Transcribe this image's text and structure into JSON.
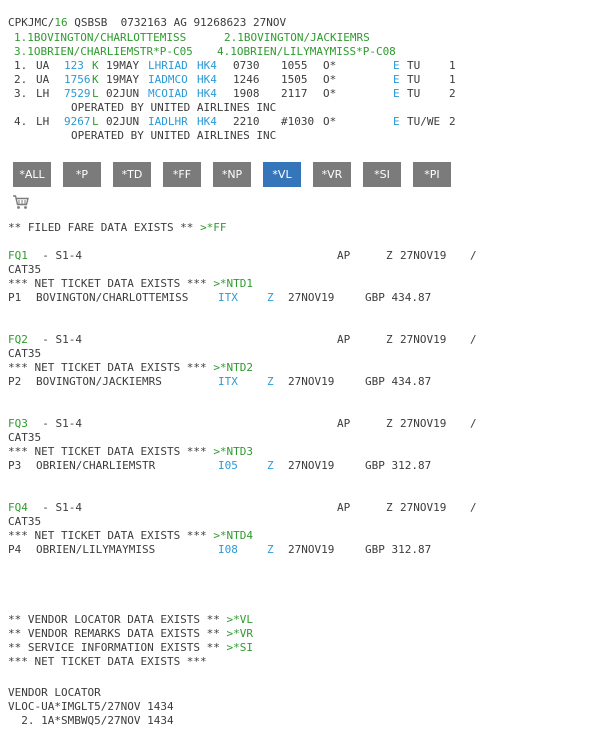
{
  "pnr": {
    "header": {
      "a": "CPKJMC/",
      "b": "16",
      "c": " QSBSB  0732163 AG 91268623 27NOV"
    },
    "names": {
      "n1": "1.1BOVINGTON/CHARLOTTEMISS",
      "n2": "2.1BOVINGTON/JACKIEMRS",
      "n3": "3.1OBRIEN/CHARLIEMSTR*P-C05",
      "n4": "4.1OBRIEN/LILYMAYMISS*P-C08"
    },
    "segments": [
      {
        "num": "1.",
        "air": "UA",
        "flt": "123",
        "cls": "K",
        "date": "19MAY",
        "city": "LHRIAD",
        "st": "HK4",
        "dep": "0730",
        "arr": "1055",
        "flag": "O*",
        "e": "E",
        "day": "TU",
        "n": "1",
        "op": ""
      },
      {
        "num": "2.",
        "air": "UA",
        "flt": "1756",
        "cls": "K",
        "date": "19MAY",
        "city": "IADMCO",
        "st": "HK4",
        "dep": "1246",
        "arr": "1505",
        "flag": "O*",
        "e": "E",
        "day": "TU",
        "n": "1",
        "op": ""
      },
      {
        "num": "3.",
        "air": "LH",
        "flt": "7529",
        "cls": "L",
        "date": "02JUN",
        "city": "MCOIAD",
        "st": "HK4",
        "dep": "1908",
        "arr": "2117",
        "flag": "O*",
        "e": "E",
        "day": "TU",
        "n": "2",
        "op": "OPERATED BY UNITED AIRLINES INC"
      },
      {
        "num": "4.",
        "air": "LH",
        "flt": "9267",
        "cls": "L",
        "date": "02JUN",
        "city": "IADLHR",
        "st": "HK4",
        "dep": "2210",
        "arr": "#1030",
        "flag": "O*",
        "e": "E",
        "day": "TU/WE",
        "n": "2",
        "op": "OPERATED BY UNITED AIRLINES INC"
      }
    ]
  },
  "toolbar": {
    "buttons": [
      "*ALL",
      "*P",
      "*TD",
      "*FF",
      "*NP",
      "*VL",
      "*VR",
      "*SI",
      "*PI"
    ],
    "active": "*VL"
  },
  "filed_fare": {
    "text": "** FILED FARE DATA EXISTS ** ",
    "link": ">*FF"
  },
  "fares": [
    {
      "fq": "FQ1",
      "seg": "  - S1-4",
      "ap": "AP",
      "z": "Z",
      "date": "27NOV19",
      "slash": "/",
      "cat": "CAT35",
      "nt_text": "*** NET TICKET DATA EXISTS *** ",
      "nt_link": ">*NTD1",
      "p": "P1",
      "name": "BOVINGTON/CHARLOTTEMISS",
      "code": "ITX",
      "zz": "Z",
      "fdate": "27NOV19",
      "amount": "GBP 434.87"
    },
    {
      "fq": "FQ2",
      "seg": "  - S1-4",
      "ap": "AP",
      "z": "Z",
      "date": "27NOV19",
      "slash": "/",
      "cat": "CAT35",
      "nt_text": "*** NET TICKET DATA EXISTS *** ",
      "nt_link": ">*NTD2",
      "p": "P2",
      "name": "BOVINGTON/JACKIEMRS",
      "code": "ITX",
      "zz": "Z",
      "fdate": "27NOV19",
      "amount": "GBP 434.87"
    },
    {
      "fq": "FQ3",
      "seg": "  - S1-4",
      "ap": "AP",
      "z": "Z",
      "date": "27NOV19",
      "slash": "/",
      "cat": "CAT35",
      "nt_text": "*** NET TICKET DATA EXISTS *** ",
      "nt_link": ">*NTD3",
      "p": "P3",
      "name": "OBRIEN/CHARLIEMSTR",
      "code": "I05",
      "zz": "Z",
      "fdate": "27NOV19",
      "amount": "GBP 312.87"
    },
    {
      "fq": "FQ4",
      "seg": "  - S1-4",
      "ap": "AP",
      "z": "Z",
      "date": "27NOV19",
      "slash": "/",
      "cat": "CAT35",
      "nt_text": "*** NET TICKET DATA EXISTS *** ",
      "nt_link": ">*NTD4",
      "p": "P4",
      "name": "OBRIEN/LILYMAYMISS",
      "code": "I08",
      "zz": "Z",
      "fdate": "27NOV19",
      "amount": "GBP 312.87"
    }
  ],
  "exists": [
    {
      "text": "** VENDOR LOCATOR DATA EXISTS ** ",
      "link": ">*VL"
    },
    {
      "text": "** VENDOR REMARKS DATA EXISTS ** ",
      "link": ">*VR"
    },
    {
      "text": "** SERVICE INFORMATION EXISTS ** ",
      "link": ">*SI"
    },
    {
      "text": "*** NET TICKET DATA EXISTS ***",
      "link": ""
    }
  ],
  "vendor": {
    "title": "VENDOR LOCATOR",
    "lines": [
      "VLOC-UA*IMGLT5/27NOV 1434",
      "  2. 1A*SMBWQ5/27NOV 1434"
    ]
  }
}
